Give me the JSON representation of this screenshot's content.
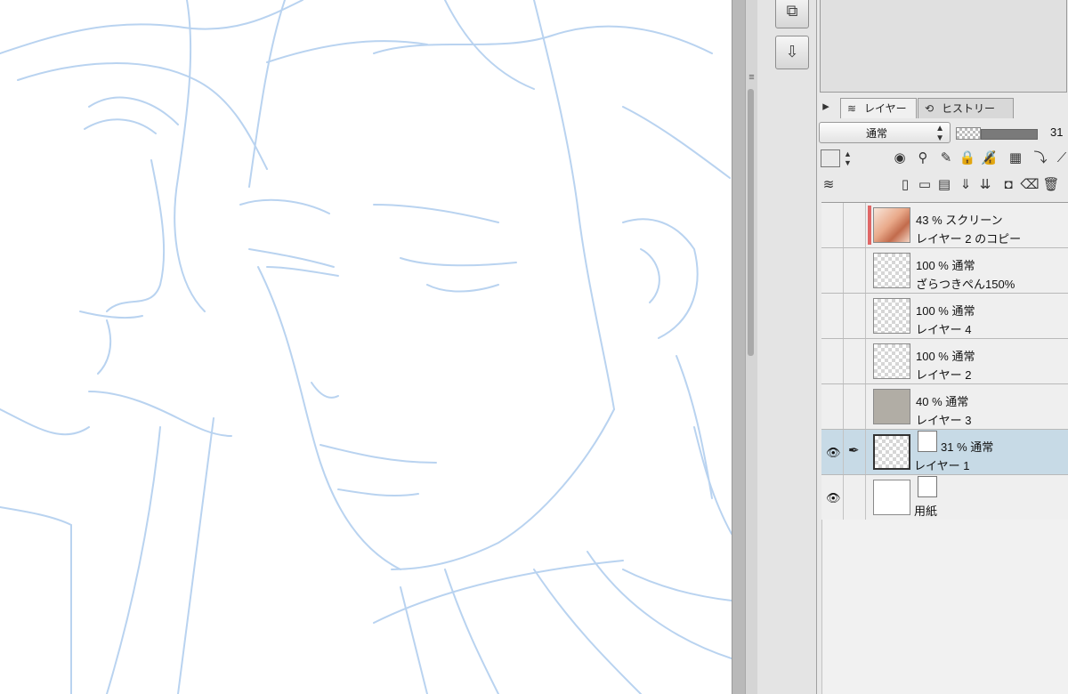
{
  "layer_panel": {
    "tabs": [
      {
        "label": "レイヤー",
        "icon": "layers-icon",
        "active": true
      },
      {
        "label": "ヒストリー",
        "icon": "history-icon",
        "active": false
      }
    ],
    "blend_mode": "通常",
    "opacity": "31",
    "layers": [
      {
        "opacity_mode": "43 % スクリーン",
        "name": "レイヤー 2 のコピー",
        "thumbnail": "portrait",
        "visible": false,
        "selected": false
      },
      {
        "opacity_mode": "100 % 通常",
        "name": "ざらつきぺん150%",
        "thumbnail": "transparent",
        "visible": false,
        "selected": false
      },
      {
        "opacity_mode": "100 % 通常",
        "name": "レイヤー 4",
        "thumbnail": "transparent",
        "visible": false,
        "selected": false
      },
      {
        "opacity_mode": "100 % 通常",
        "name": "レイヤー 2",
        "thumbnail": "transparent",
        "visible": false,
        "selected": false
      },
      {
        "opacity_mode": "40 % 通常",
        "name": "レイヤー 3",
        "thumbnail": "gray",
        "visible": false,
        "selected": false
      },
      {
        "opacity_mode": "31 % 通常",
        "name": "レイヤー 1",
        "thumbnail": "transparent",
        "visible": true,
        "selected": true
      },
      {
        "opacity_mode": "",
        "name": "用紙",
        "thumbnail": "white",
        "visible": true,
        "selected": false
      }
    ]
  },
  "colors": {
    "sketch_stroke": "#b9d3f0",
    "selected_layer": "#c7dae6",
    "clipping_bar": "#e06767"
  }
}
